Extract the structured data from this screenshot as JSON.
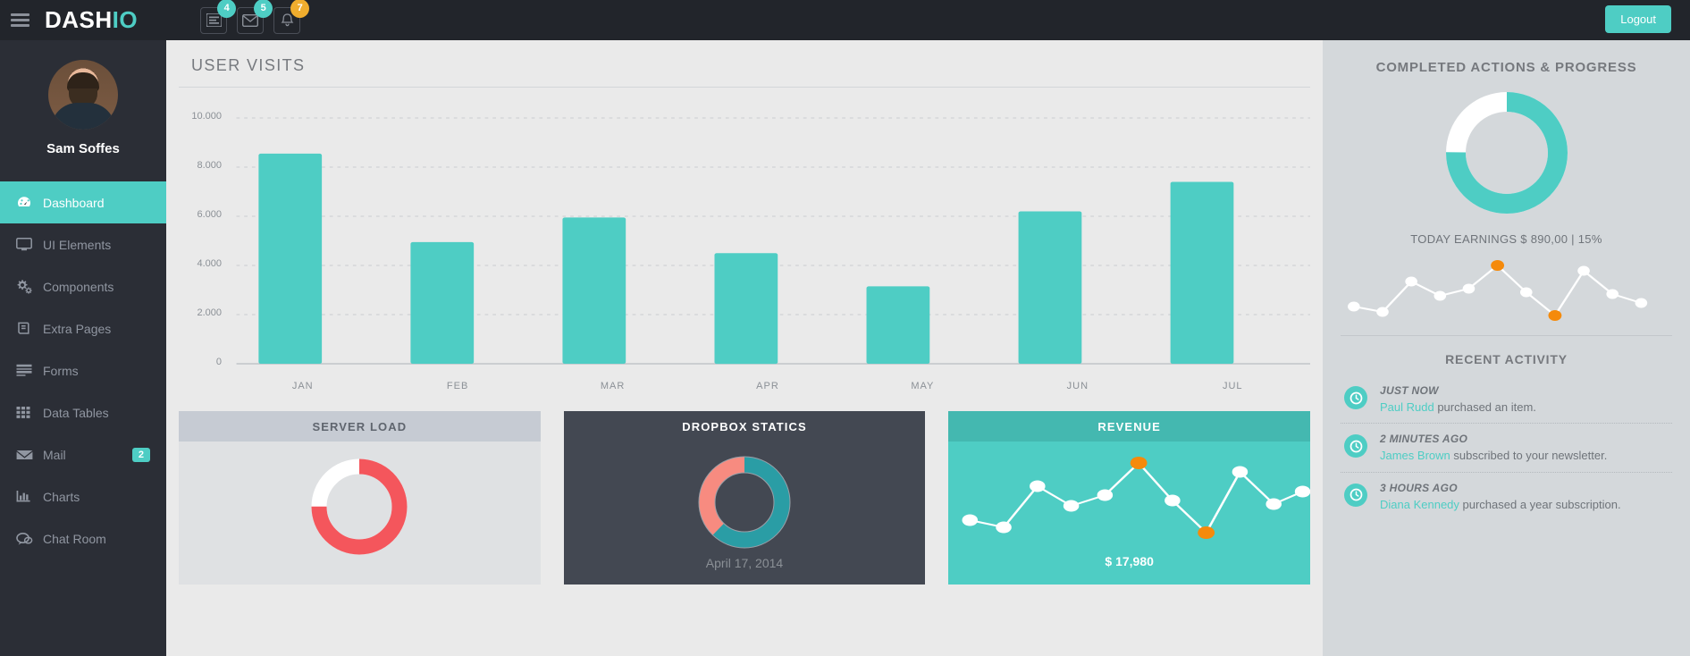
{
  "header": {
    "menu_icon": "hamburger-icon",
    "brand_part1": "DASH",
    "brand_part2": "IO",
    "icons": [
      {
        "name": "tasks-icon",
        "badge": "4",
        "badge_color": "#4ecdc4"
      },
      {
        "name": "envelope-icon",
        "badge": "5",
        "badge_color": "#4ecdc4"
      },
      {
        "name": "bell-icon",
        "badge": "7",
        "badge_color": "#f0ad2e"
      }
    ],
    "logout_label": "Logout"
  },
  "sidebar": {
    "user_name": "Sam Soffes",
    "items": [
      {
        "label": "Dashboard",
        "icon": "dashboard-icon",
        "active": true,
        "badge": ""
      },
      {
        "label": "UI Elements",
        "icon": "monitor-icon",
        "active": false,
        "badge": ""
      },
      {
        "label": "Components",
        "icon": "gears-icon",
        "active": false,
        "badge": ""
      },
      {
        "label": "Extra Pages",
        "icon": "book-icon",
        "active": false,
        "badge": ""
      },
      {
        "label": "Forms",
        "icon": "form-icon",
        "active": false,
        "badge": ""
      },
      {
        "label": "Data Tables",
        "icon": "grid-icon",
        "active": false,
        "badge": ""
      },
      {
        "label": "Mail",
        "icon": "envelope-icon",
        "active": false,
        "badge": "2"
      },
      {
        "label": "Charts",
        "icon": "bar-chart-icon",
        "active": false,
        "badge": ""
      },
      {
        "label": "Chat Room",
        "icon": "chat-icon",
        "active": false,
        "badge": ""
      }
    ]
  },
  "main": {
    "title": "USER VISITS",
    "cards": [
      {
        "title": "SERVER LOAD",
        "caption": ""
      },
      {
        "title": "DROPBOX STATICS",
        "caption": "April 17, 2014"
      },
      {
        "title": "REVENUE",
        "caption": "$ 17,980"
      }
    ]
  },
  "rightbar": {
    "progress_title": "COMPLETED ACTIONS & PROGRESS",
    "earnings": "TODAY EARNINGS $ 890,00 | 15%",
    "activity_title": "RECENT ACTIVITY",
    "activities": [
      {
        "time": "JUST NOW",
        "who": "Paul Rudd",
        "text": " purchased an item."
      },
      {
        "time": "2 MINUTES AGO",
        "who": "James Brown",
        "text": " subscribed to your newsletter."
      },
      {
        "time": "3 HOURS AGO",
        "who": "Diana Kennedy",
        "text": " purchased a year subscription."
      }
    ]
  },
  "colors": {
    "teal": "#4ecdc4",
    "teal_dark": "#44b8b0",
    "red": "#f4565c",
    "salmon": "#f78b80",
    "cyan": "#2a9da5",
    "orange": "#f58a0b",
    "amber": "#f0ad2e",
    "sidebar_bg": "#2b2e36",
    "topbar_bg": "#22252b"
  },
  "chart_data": [
    {
      "type": "bar",
      "title": "USER VISITS",
      "categories": [
        "JAN",
        "FEB",
        "MAR",
        "APR",
        "MAY",
        "JUN",
        "JUL"
      ],
      "values": [
        8550,
        4950,
        5950,
        4500,
        3150,
        6200,
        7400
      ],
      "ytick_labels": [
        "0",
        "2.000",
        "4.000",
        "6.000",
        "8.000",
        "10.000"
      ],
      "ytick_values": [
        0,
        2000,
        4000,
        6000,
        8000,
        10000
      ],
      "ylim": [
        0,
        10000
      ],
      "xlabel": "",
      "ylabel": "",
      "grid": true,
      "legend": false,
      "bar_color": "#4ecdc4"
    },
    {
      "type": "pie",
      "title": "COMPLETED ACTIONS & PROGRESS",
      "labels": [
        "completed",
        "remaining"
      ],
      "values": [
        75,
        25
      ],
      "colors": [
        "#4ecdc4",
        "#ffffff"
      ],
      "donut": true,
      "start_angle_deg": 0
    },
    {
      "type": "line",
      "title": "progress-sparkline",
      "x": [
        1,
        2,
        3,
        4,
        5,
        6,
        7,
        8,
        9,
        10,
        11
      ],
      "values": [
        18,
        12,
        58,
        34,
        48,
        88,
        45,
        8,
        80,
        42,
        32
      ],
      "ylim": [
        0,
        100
      ],
      "grid": false,
      "legend": false,
      "line_color": "#ffffff",
      "point_color": "#ffffff",
      "highlight_indices": [
        5,
        7
      ],
      "highlight_color": "#f58a0b"
    },
    {
      "type": "pie",
      "title": "SERVER LOAD",
      "labels": [
        "load",
        "free"
      ],
      "values": [
        75,
        25
      ],
      "colors": [
        "#f4565c",
        "#ffffff"
      ],
      "donut": true,
      "start_angle_deg": 0
    },
    {
      "type": "pie",
      "title": "DROPBOX STATICS",
      "labels": [
        "used",
        "free"
      ],
      "values": [
        62,
        38
      ],
      "colors": [
        "#2a9da5",
        "#f78b80"
      ],
      "donut": true,
      "start_angle_deg": 0
    },
    {
      "type": "line",
      "title": "REVENUE",
      "x": [
        1,
        2,
        3,
        4,
        5,
        6,
        7,
        8,
        9,
        10,
        11
      ],
      "values": [
        18,
        12,
        58,
        34,
        48,
        88,
        45,
        8,
        80,
        42,
        32
      ],
      "ylim": [
        0,
        100
      ],
      "grid": false,
      "legend": false,
      "line_color": "#ffffff",
      "point_color": "#ffffff",
      "highlight_indices": [
        5,
        7
      ],
      "highlight_color": "#f58a0b",
      "value_label": "$ 17,980"
    }
  ]
}
